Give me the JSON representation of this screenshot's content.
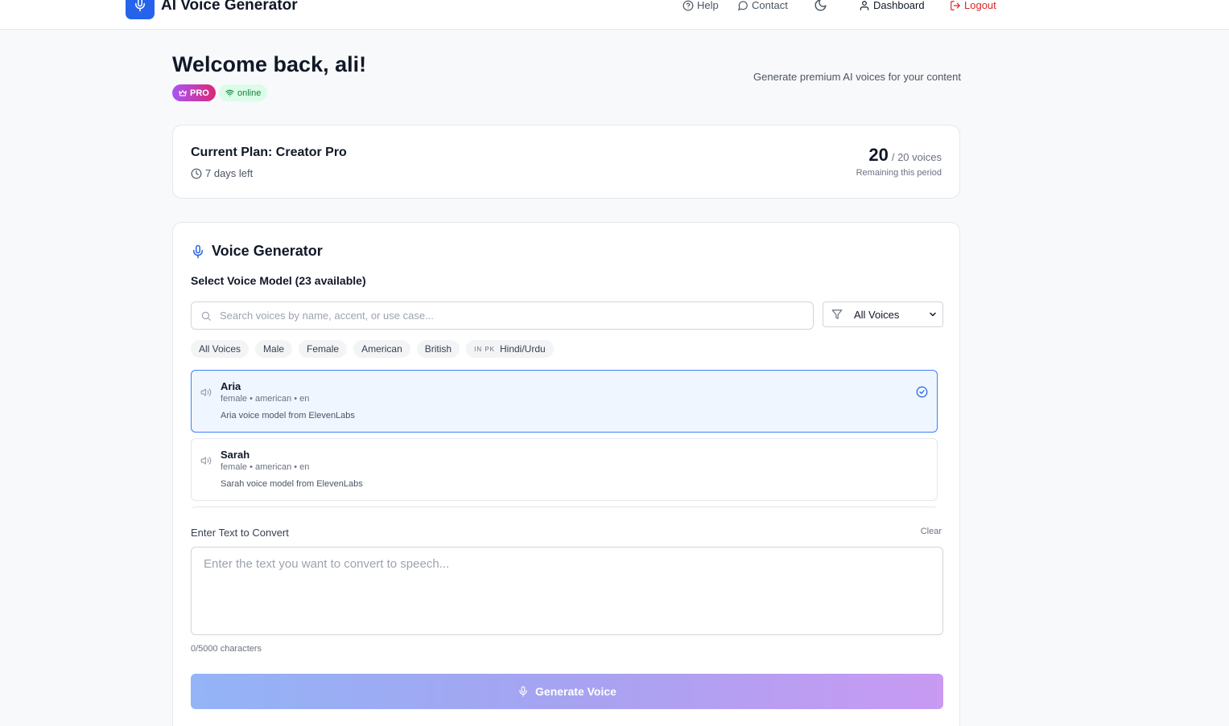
{
  "app": {
    "title": "AI Voice Generator"
  },
  "nav": {
    "help": "Help",
    "contact": "Contact",
    "dashboard": "Dashboard",
    "logout": "Logout"
  },
  "welcome": {
    "heading": "Welcome back, ali!",
    "badge_pro": "PRO",
    "badge_online": "online",
    "tagline": "Generate premium AI voices for your content"
  },
  "plan": {
    "title": "Current Plan: Creator Pro",
    "days_left": "7 days left",
    "remaining": "20",
    "total": "/ 20 voices",
    "remaining_label": "Remaining this period"
  },
  "generator": {
    "title": "Voice Generator",
    "select_label": "Select Voice Model (23 available)",
    "search_placeholder": "Search voices by name, accent, or use case...",
    "filter_selected": "All Voices",
    "chips": [
      {
        "label": "All Voices"
      },
      {
        "label": "Male"
      },
      {
        "label": "Female"
      },
      {
        "label": "American"
      },
      {
        "label": "British"
      },
      {
        "flag": "IN PK",
        "label": "Hindi/Urdu"
      }
    ],
    "voices": [
      {
        "name": "Aria",
        "meta": "female • american • en",
        "description": "Aria voice model from ElevenLabs",
        "selected": true
      },
      {
        "name": "Sarah",
        "meta": "female • american • en",
        "description": "Sarah voice model from ElevenLabs",
        "selected": false
      }
    ],
    "text_label": "Enter Text to Convert",
    "clear_label": "Clear",
    "text_placeholder": "Enter the text you want to convert to speech...",
    "char_count": "0/5000 characters",
    "generate_label": "Generate Voice"
  },
  "colors": {
    "accent": "#2563eb",
    "logout": "#dc2626",
    "selected_bg": "#eff6ff",
    "selected_border": "#3b82f6"
  }
}
